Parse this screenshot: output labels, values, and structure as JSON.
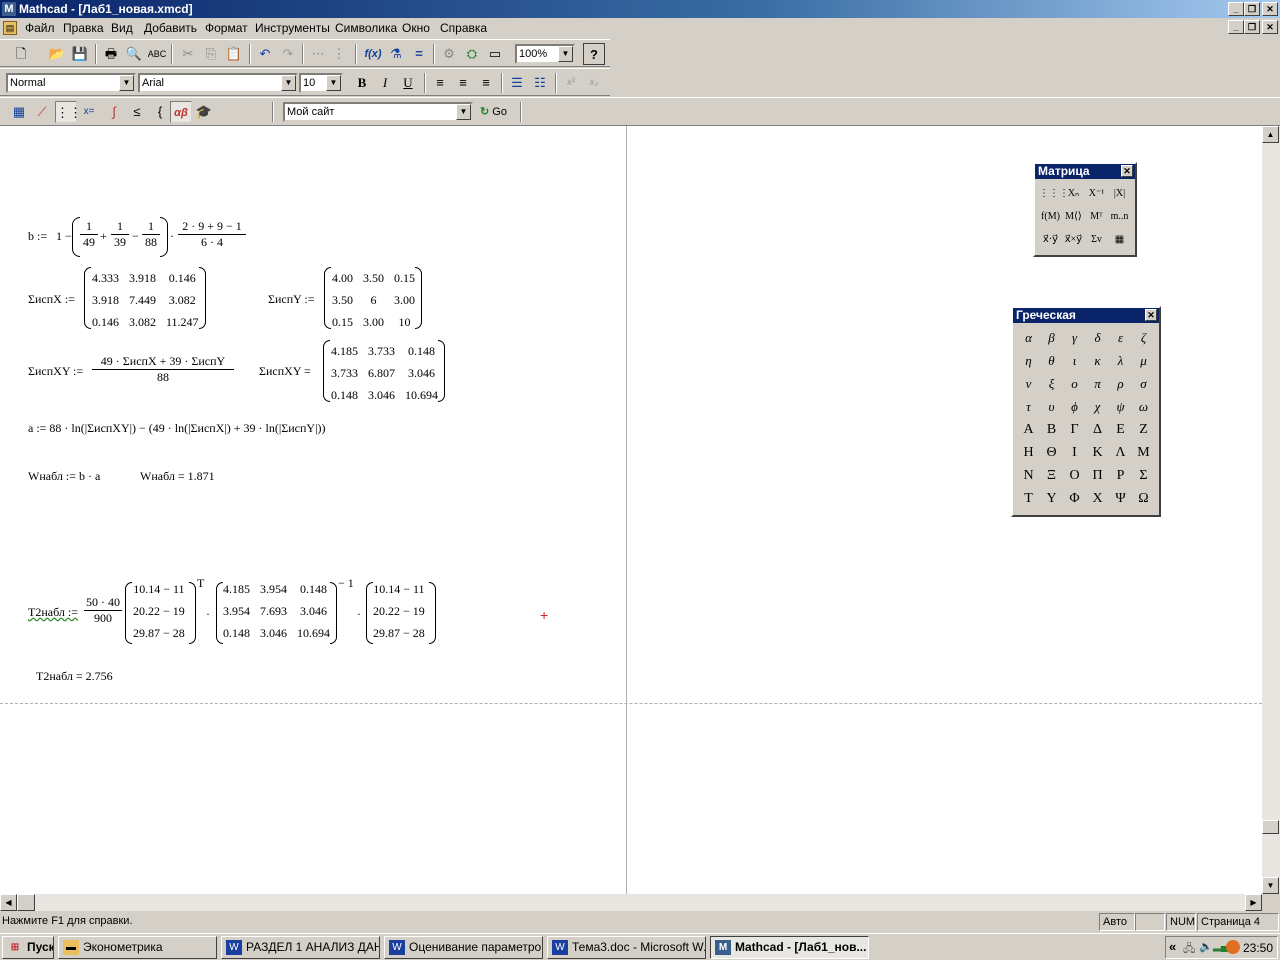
{
  "window": {
    "title": "Mathcad - [Лаб1_новая.xmcd]"
  },
  "menu": [
    "Файл",
    "Правка",
    "Вид",
    "Добавить",
    "Формат",
    "Инструменты",
    "Символика",
    "Окно",
    "Справка"
  ],
  "format_bar": {
    "style": "Normal",
    "font": "Arial",
    "size": "10",
    "bold": "B",
    "italic": "I",
    "underline": "U"
  },
  "standard_bar": {
    "zoom": "100%"
  },
  "resource_bar": {
    "site": "Мой сайт",
    "go": "Go"
  },
  "doc": {
    "b_lhs": "b :=",
    "b_parts": [
      "1 −",
      "+",
      "−",
      "·"
    ],
    "b_fracs": [
      [
        "1",
        "49"
      ],
      [
        "1",
        "39"
      ],
      [
        "1",
        "88"
      ],
      [
        "2 · 9 + 9 − 1",
        "6 · 4"
      ]
    ],
    "sx_label": "ΣиспX :=",
    "sx": [
      [
        "4.333",
        "3.918",
        "0.146"
      ],
      [
        "3.918",
        "7.449",
        "3.082"
      ],
      [
        "0.146",
        "3.082",
        "11.247"
      ]
    ],
    "sy_label": "ΣиспY :=",
    "sy": [
      [
        "4.00",
        "3.50",
        "0.15"
      ],
      [
        "3.50",
        "6",
        "3.00"
      ],
      [
        "0.15",
        "3.00",
        "10"
      ]
    ],
    "sxy_def_label": "ΣиспXY :=",
    "sxy_num": "49 · ΣиспX + 39 · ΣиспY",
    "sxy_den": "88",
    "sxy_label": "ΣиспXY =",
    "sxy": [
      [
        "4.185",
        "3.733",
        "0.148"
      ],
      [
        "3.733",
        "6.807",
        "3.046"
      ],
      [
        "0.148",
        "3.046",
        "10.694"
      ]
    ],
    "a_expr": "a := 88 · ln(|ΣиспXY|) − (49 · ln(|ΣиспX|) + 39 · ln(|ΣиспY|))",
    "w_def": "Wнабл := b · a",
    "w_res": "Wнабл = 1.871",
    "t2_label": "T2набл :=",
    "t2_num": "50 · 40",
    "t2_den": "900",
    "t2_vec": [
      "10.14 − 11",
      "20.22 − 19",
      "29.87 − 28"
    ],
    "t2_T": "T",
    "t2_mid": [
      [
        "4.185",
        "3.954",
        "0.148"
      ],
      [
        "3.954",
        "7.693",
        "3.046"
      ],
      [
        "0.148",
        "3.046",
        "10.694"
      ]
    ],
    "t2_inv": "− 1",
    "t2_dot": "·",
    "t2_res": "T2набл = 2.756"
  },
  "matrix_panel": {
    "title": "Матрица",
    "cells": [
      "⋮⋮⋮",
      "Xₙ",
      "X⁻¹",
      "|X|",
      "f(M)",
      "M⟨⟩",
      "Mᵀ",
      "m..n",
      "x⃗·y⃗",
      "x⃗×y⃗",
      "Σv",
      "▦"
    ]
  },
  "greek_panel": {
    "title": "Греческая",
    "letters": [
      "α",
      "β",
      "γ",
      "δ",
      "ε",
      "ζ",
      "η",
      "θ",
      "ι",
      "κ",
      "λ",
      "μ",
      "ν",
      "ξ",
      "ο",
      "π",
      "ρ",
      "σ",
      "τ",
      "υ",
      "ϕ",
      "χ",
      "ψ",
      "ω",
      "Α",
      "Β",
      "Γ",
      "Δ",
      "Ε",
      "Ζ",
      "Η",
      "Θ",
      "Ι",
      "Κ",
      "Λ",
      "Μ",
      "Ν",
      "Ξ",
      "Ο",
      "Π",
      "Ρ",
      "Σ",
      "Τ",
      "Υ",
      "Φ",
      "Χ",
      "Ψ",
      "Ω"
    ]
  },
  "status": {
    "help": "Нажмите F1 для справки.",
    "mode": "Авто",
    "num": "NUM",
    "page": "Страница 4"
  },
  "taskbar": {
    "start": "Пуск",
    "tasks": [
      "Эконометрика",
      "РАЗДЕЛ 1 АНАЛИЗ ДАН...",
      "Оценивание параметро...",
      "Тема3.doc - Microsoft W...",
      "Mathcad - [Лаб1_нов..."
    ],
    "clock": "23:50"
  }
}
